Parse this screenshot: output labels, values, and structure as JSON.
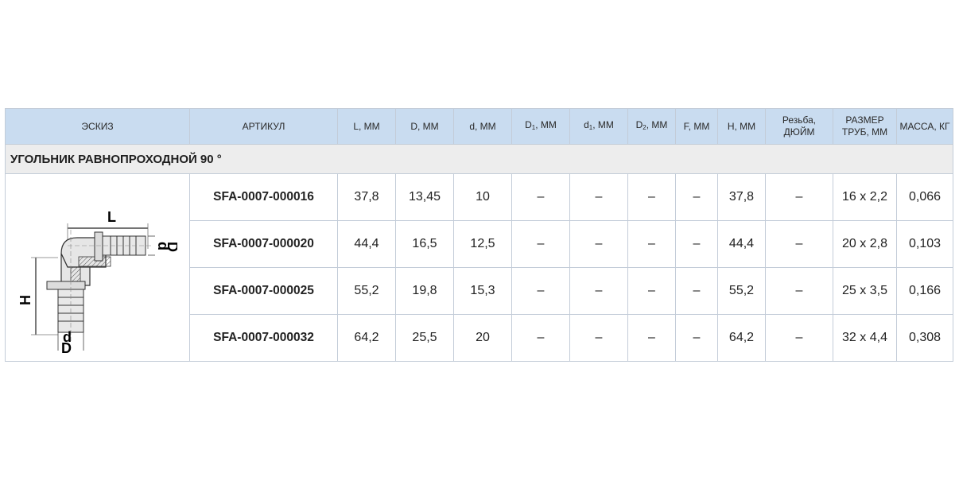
{
  "headers": {
    "sketch": "ЭСКИЗ",
    "article": "АРТИКУЛ",
    "L": "L, ММ",
    "D": "D, ММ",
    "d": "d, ММ",
    "D1_main": "D",
    "D1_sub": "1",
    "D1_unit": ", ММ",
    "d1_main": "d",
    "d1_sub": "1",
    "d1_unit": ", ММ",
    "D2_main": "D",
    "D2_sub": "2",
    "D2_unit": ", ММ",
    "F": "F, ММ",
    "H": "H, ММ",
    "thread_line1": "Резьба,",
    "thread_line2": "ДЮЙМ",
    "pipe_line1": "РАЗМЕР",
    "pipe_line2": "ТРУБ, ММ",
    "mass": "МАССА, КГ"
  },
  "section_title": "УГОЛЬНИК РАВНОПРОХОДНОЙ 90 °",
  "sketch_labels": {
    "L": "L",
    "H": "H",
    "d_right": "d",
    "D_right": "D",
    "d_bottom": "d",
    "D_bottom": "D"
  },
  "rows": [
    {
      "article": "SFA-0007-000016",
      "L": "37,8",
      "D": "13,45",
      "d": "10",
      "D1": "–",
      "d1": "–",
      "D2": "–",
      "F": "–",
      "H": "37,8",
      "thread": "–",
      "pipe": "16 x 2,2",
      "mass": "0,066"
    },
    {
      "article": "SFA-0007-000020",
      "L": "44,4",
      "D": "16,5",
      "d": "12,5",
      "D1": "–",
      "d1": "–",
      "D2": "–",
      "F": "–",
      "H": "44,4",
      "thread": "–",
      "pipe": "20 x 2,8",
      "mass": "0,103"
    },
    {
      "article": "SFA-0007-000025",
      "L": "55,2",
      "D": "19,8",
      "d": "15,3",
      "D1": "–",
      "d1": "–",
      "D2": "–",
      "F": "–",
      "H": "55,2",
      "thread": "–",
      "pipe": "25 x 3,5",
      "mass": "0,166"
    },
    {
      "article": "SFA-0007-000032",
      "L": "64,2",
      "D": "25,5",
      "d": "20",
      "D1": "–",
      "d1": "–",
      "D2": "–",
      "F": "–",
      "H": "64,2",
      "thread": "–",
      "pipe": "32 x 4,4",
      "mass": "0,308"
    }
  ],
  "colors": {
    "header_bg": "#c9dcf0",
    "section_bg": "#ededed",
    "border": "#c3ccd8"
  }
}
